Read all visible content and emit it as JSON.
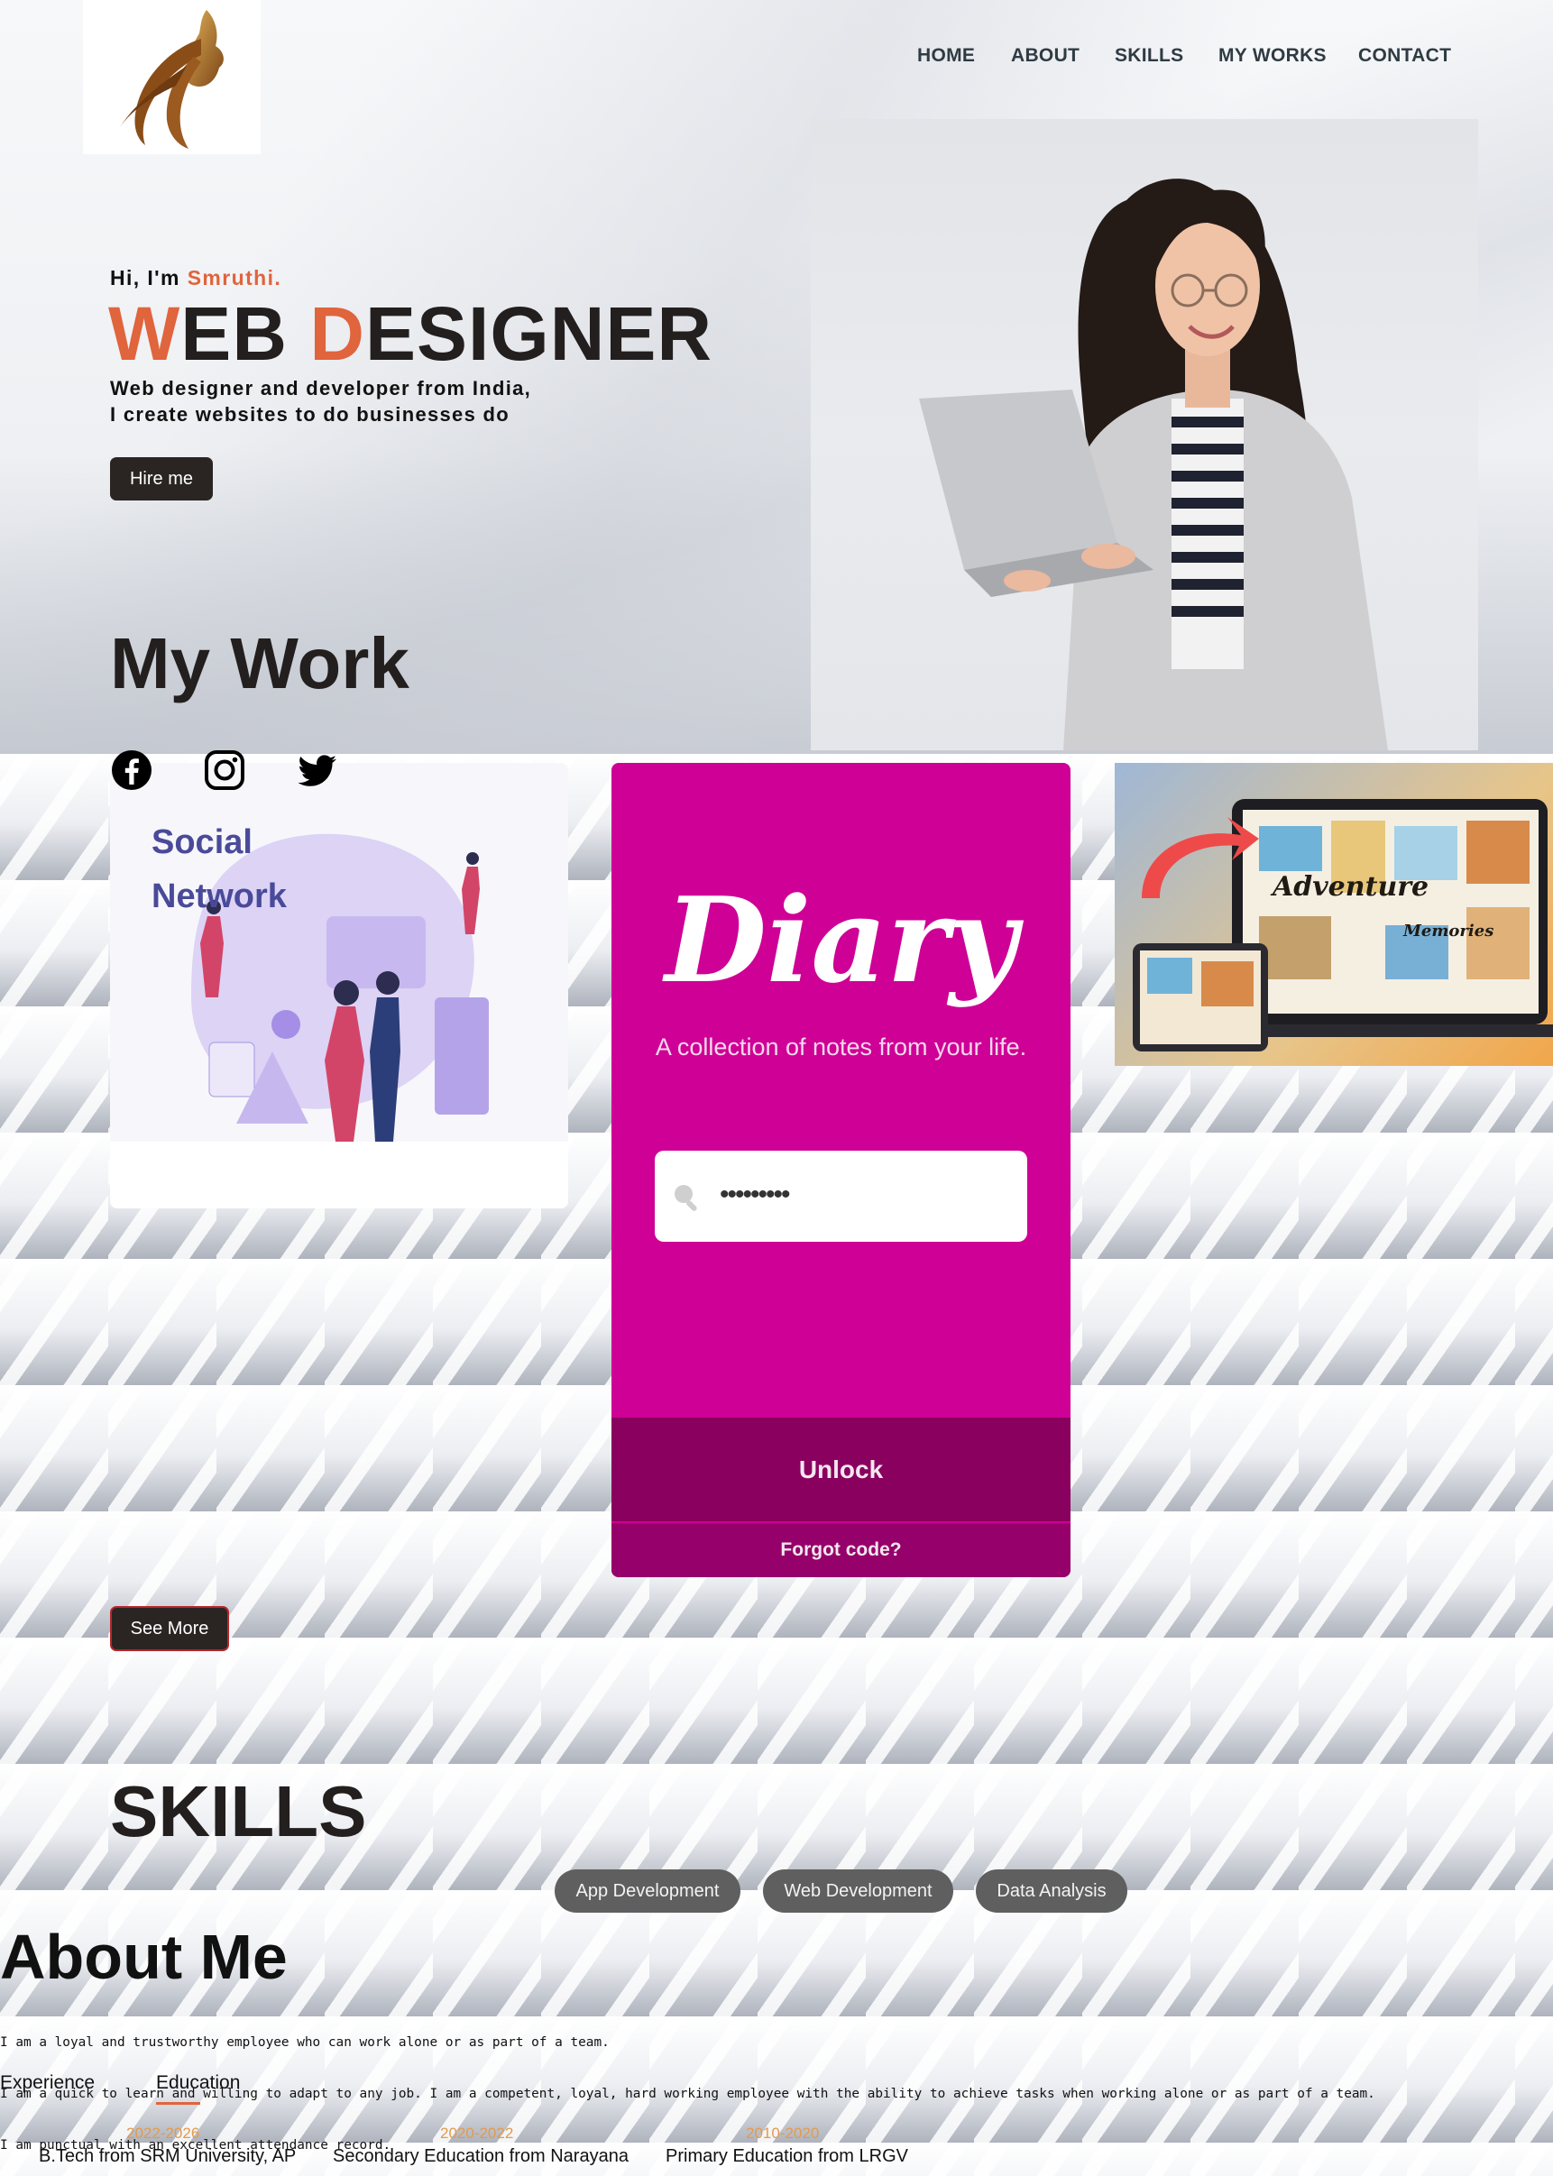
{
  "nav": {
    "home": "HOME",
    "about": "ABOUT",
    "skills": "SKILLS",
    "works": "MY WORKS",
    "contact": "CONTACT"
  },
  "hero": {
    "greeting_prefix": "Hi, I'm ",
    "greeting_name": "Smruthi.",
    "headline_w": "W",
    "headline_eb": "EB ",
    "headline_d": "D",
    "headline_esigner": "ESIGNER",
    "subline_1": "Web designer and developer from India,",
    "subline_2": "I create websites to do businesses do",
    "hire_button": "Hire me"
  },
  "work": {
    "title": "My Work",
    "card1_caption_1": "Social",
    "card1_caption_2": "Network",
    "diary": {
      "title": "Diary",
      "subtitle": "A collection of notes from your life.",
      "input_value": "•••••••••",
      "unlock": "Unlock",
      "forgot": "Forgot code?"
    },
    "card3_caption_1": "Adventure",
    "card3_caption_2": "Memories",
    "see_more": "See More"
  },
  "skills": {
    "title": "SKILLS",
    "items": [
      "App Development",
      "Web Development",
      "Data Analysis"
    ]
  },
  "about": {
    "title": "About Me",
    "lines": [
      "I am a loyal and trustworthy employee who can work alone or as part of a team.",
      "I am a quick to learn and willing to adapt to any job. I am a competent, loyal, hard working employee with the ability to achieve tasks when working alone or as part of a team.",
      "I am punctual with an excellent attendance record."
    ],
    "tabs": [
      "Experience",
      "Education"
    ],
    "education": [
      {
        "year": "2022-2026",
        "item": "B.Tech from SRM University, AP"
      },
      {
        "year": "2020-2022",
        "item": "Secondary Education from Narayana"
      },
      {
        "year": "2010-2020",
        "item": "Primary Education from LRGV"
      }
    ]
  },
  "colors": {
    "accent": "#e0643c",
    "dark": "#231f1e",
    "diary_pink": "#ce0096",
    "diary_dark": "#89005f",
    "pill_gray": "#5f5f5f"
  },
  "icons": [
    "facebook-icon",
    "instagram-icon",
    "twitter-icon",
    "search-icon"
  ]
}
